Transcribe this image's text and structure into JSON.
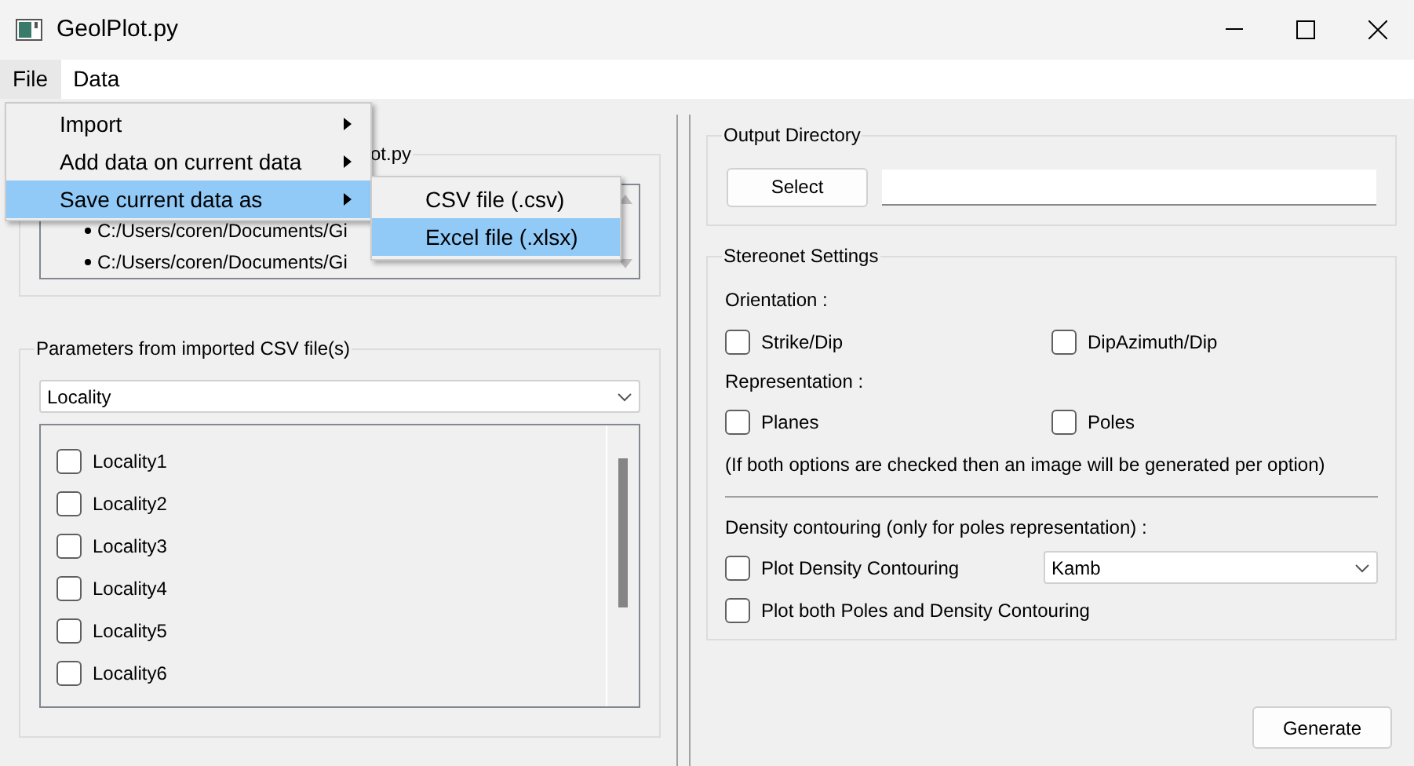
{
  "window": {
    "title": "GeolPlot.py"
  },
  "menubar": [
    {
      "label": "File",
      "selected": true
    },
    {
      "label": "Data",
      "selected": false
    }
  ],
  "file_menu": [
    {
      "label": "Import",
      "selected": false
    },
    {
      "label": "Add data on current data",
      "selected": false
    },
    {
      "label": "Save current data as",
      "selected": true
    }
  ],
  "save_submenu": [
    {
      "label": "CSV file (.csv)",
      "selected": false
    },
    {
      "label": "Excel file (.xlsx)",
      "selected": true
    }
  ],
  "files_group": {
    "title": "ot.py",
    "files": [
      "C:/Users/coren/Documents/Gi",
      "C:/Users/coren/Documents/Gi"
    ]
  },
  "parameters": {
    "title": "Parameters from imported CSV file(s)",
    "dropdown": "Locality",
    "items": [
      {
        "label": "Locality1",
        "checked": false
      },
      {
        "label": "Locality2",
        "checked": false
      },
      {
        "label": "Locality3",
        "checked": false
      },
      {
        "label": "Locality4",
        "checked": false
      },
      {
        "label": "Locality5",
        "checked": false
      },
      {
        "label": "Locality6",
        "checked": false
      }
    ]
  },
  "output_directory": {
    "title": "Output Directory",
    "button": "Select"
  },
  "stereonet": {
    "title": "Stereonet Settings",
    "orientation_label": "Orientation :",
    "orientation": [
      {
        "label": "Strike/Dip",
        "checked": false
      },
      {
        "label": "DipAzimuth/Dip",
        "checked": false
      }
    ],
    "representation_label": "Representation :",
    "representation": [
      {
        "label": "Planes",
        "checked": false
      },
      {
        "label": "Poles",
        "checked": false
      }
    ],
    "note": "(If both options are checked then an image will be generated per option)",
    "density_label": "Density contouring (only for poles representation) :",
    "density_checkbox": {
      "label": "Plot Density Contouring",
      "checked": false
    },
    "density_method": "Kamb",
    "both_checkbox": {
      "label": "Plot both Poles and Density Contouring",
      "checked": false
    }
  },
  "generate_button": "Generate"
}
